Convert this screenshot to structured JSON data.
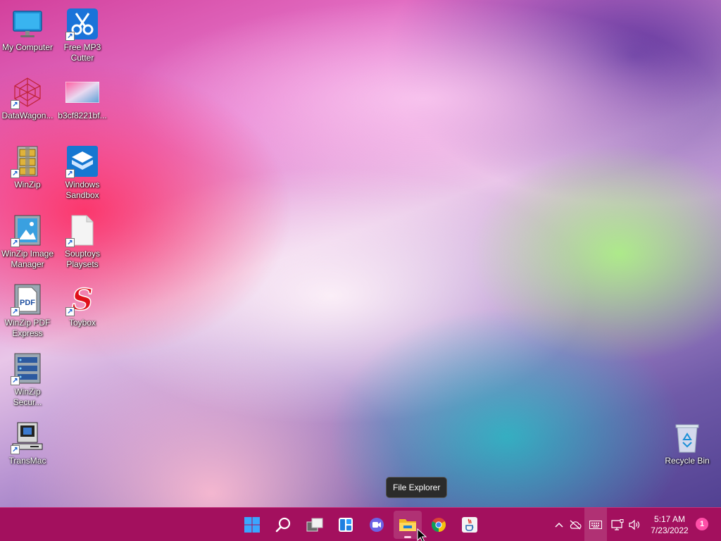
{
  "desktop": {
    "icons": [
      {
        "label": "My Computer",
        "icon": "monitor-icon"
      },
      {
        "label": "Free MP3 Cutter",
        "icon": "scissors-icon"
      },
      {
        "label": "DataWagon...",
        "icon": "network-mesh-icon"
      },
      {
        "label": "b3cf8221bf...",
        "icon": "image-thumbnail-icon"
      },
      {
        "label": "WinZip",
        "icon": "zip-cabinet-icon"
      },
      {
        "label": "Windows Sandbox",
        "icon": "sandbox-icon"
      },
      {
        "label": "WinZip Image Manager",
        "icon": "image-manager-icon"
      },
      {
        "label": "Souptoys Playsets",
        "icon": "blank-document-icon"
      },
      {
        "label": "WinZip PDF Express",
        "icon": "pdf-icon"
      },
      {
        "label": "Toybox",
        "icon": "toybox-s-icon"
      },
      {
        "label": "WinZip Secur...",
        "icon": "secure-backup-icon"
      },
      {
        "label": "TransMac",
        "icon": "retro-computer-icon"
      },
      {
        "label": "Recycle Bin",
        "icon": "recycle-bin-icon"
      }
    ]
  },
  "tooltip": {
    "text": "File Explorer"
  },
  "taskbar": {
    "background": "#a3105e",
    "apps": [
      {
        "name": "Start",
        "icon": "windows-logo-icon"
      },
      {
        "name": "Search",
        "icon": "search-icon"
      },
      {
        "name": "Task View",
        "icon": "task-view-icon"
      },
      {
        "name": "Widgets",
        "icon": "widgets-icon"
      },
      {
        "name": "Chat",
        "icon": "chat-icon"
      },
      {
        "name": "File Explorer",
        "icon": "folder-icon"
      },
      {
        "name": "Google Chrome",
        "icon": "chrome-icon"
      },
      {
        "name": "Java",
        "icon": "java-icon"
      }
    ],
    "tray": {
      "time": "5:17 AM",
      "date": "7/23/2022",
      "notification_count": "1"
    }
  }
}
